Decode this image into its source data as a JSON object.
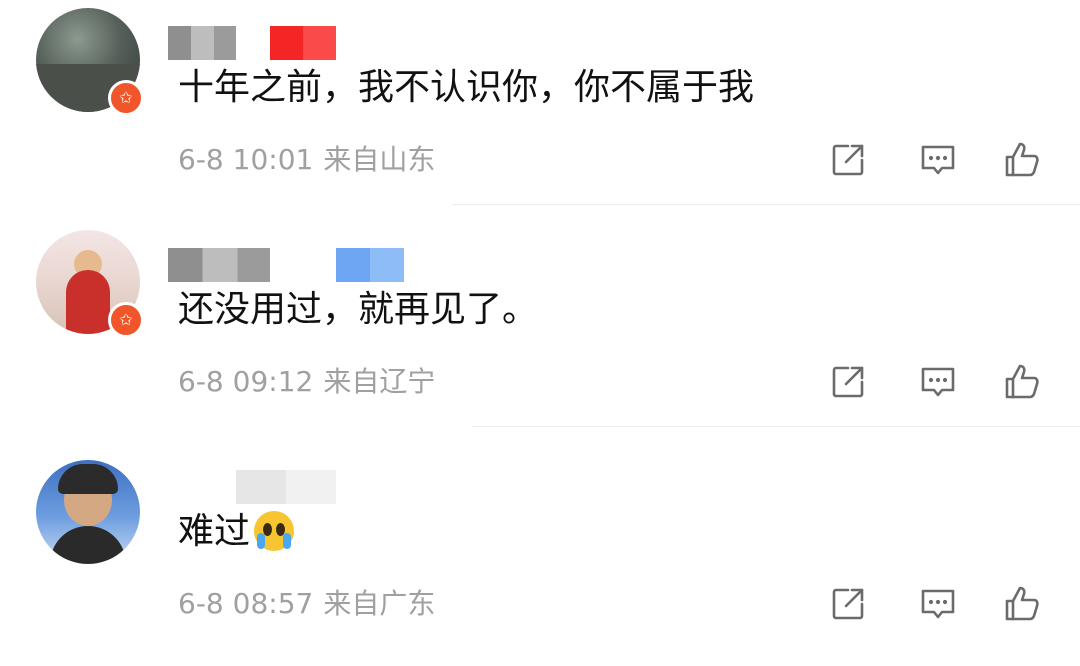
{
  "comments": [
    {
      "text": "十年之前，我不认识你，你不属于我",
      "time": "6-8 10:01",
      "location": "来自山东",
      "has_badge": true,
      "badge_symbol": "✩"
    },
    {
      "text": "还没用过，就再见了。",
      "time": "6-8 09:12",
      "location": "来自辽宁",
      "has_badge": true,
      "badge_symbol": "✩"
    },
    {
      "text": "难过",
      "emoji": "loudly-crying-face",
      "time": "6-8 08:57",
      "location": "来自广东",
      "has_badge": false
    }
  ],
  "actions": {
    "share_icon": "share-icon",
    "reply_icon": "comment-icon",
    "like_icon": "thumbs-up-icon"
  },
  "colors": {
    "badge": "#f0562a",
    "meta_text": "#a0a0a0",
    "body_text": "#111111",
    "icon_stroke": "#6b6b6b"
  }
}
